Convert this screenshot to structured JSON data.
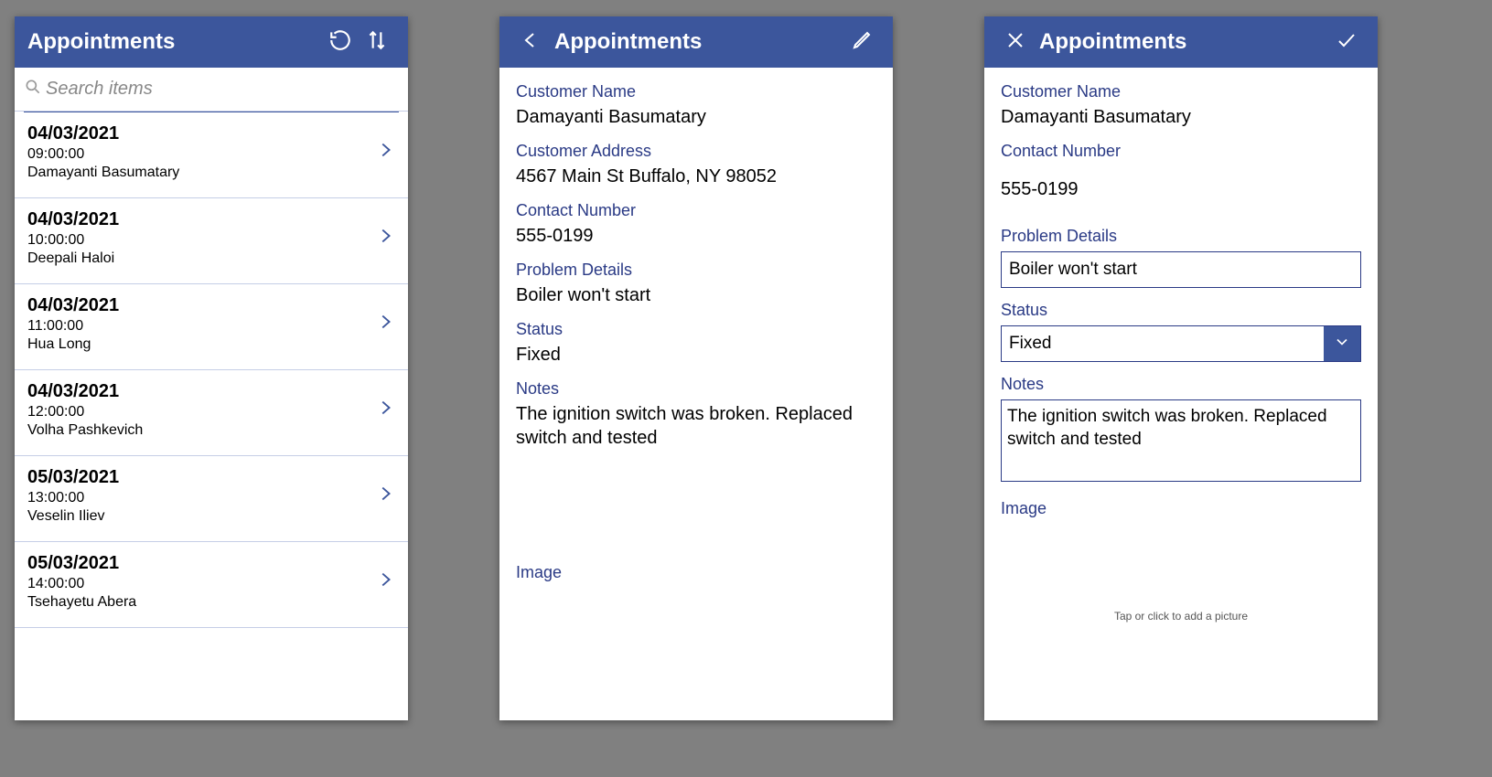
{
  "list": {
    "title": "Appointments",
    "search_placeholder": "Search items",
    "items": [
      {
        "date": "04/03/2021",
        "time": "09:00:00",
        "name": "Damayanti Basumatary"
      },
      {
        "date": "04/03/2021",
        "time": "10:00:00",
        "name": "Deepali Haloi"
      },
      {
        "date": "04/03/2021",
        "time": "11:00:00",
        "name": "Hua Long"
      },
      {
        "date": "04/03/2021",
        "time": "12:00:00",
        "name": "Volha Pashkevich"
      },
      {
        "date": "05/03/2021",
        "time": "13:00:00",
        "name": "Veselin Iliev"
      },
      {
        "date": "05/03/2021",
        "time": "14:00:00",
        "name": "Tsehayetu Abera"
      }
    ]
  },
  "detail": {
    "title": "Appointments",
    "labels": {
      "customer_name": "Customer Name",
      "customer_address": "Customer Address",
      "contact_number": "Contact Number",
      "problem_details": "Problem Details",
      "status": "Status",
      "notes": "Notes",
      "image": "Image"
    },
    "values": {
      "customer_name": "Damayanti Basumatary",
      "customer_address": "4567 Main St Buffalo, NY 98052",
      "contact_number": "555-0199",
      "problem_details": "Boiler won't start",
      "status": "Fixed",
      "notes": "The ignition switch was broken. Replaced switch and tested"
    }
  },
  "edit": {
    "title": "Appointments",
    "labels": {
      "customer_name": "Customer Name",
      "contact_number": "Contact Number",
      "problem_details": "Problem Details",
      "status": "Status",
      "notes": "Notes",
      "image": "Image"
    },
    "values": {
      "customer_name": "Damayanti Basumatary",
      "contact_number": "555-0199",
      "problem_details": "Boiler won't start",
      "status": "Fixed",
      "notes": "The ignition switch was broken. Replaced switch and tested"
    },
    "image_hint": "Tap or click to add a picture"
  }
}
